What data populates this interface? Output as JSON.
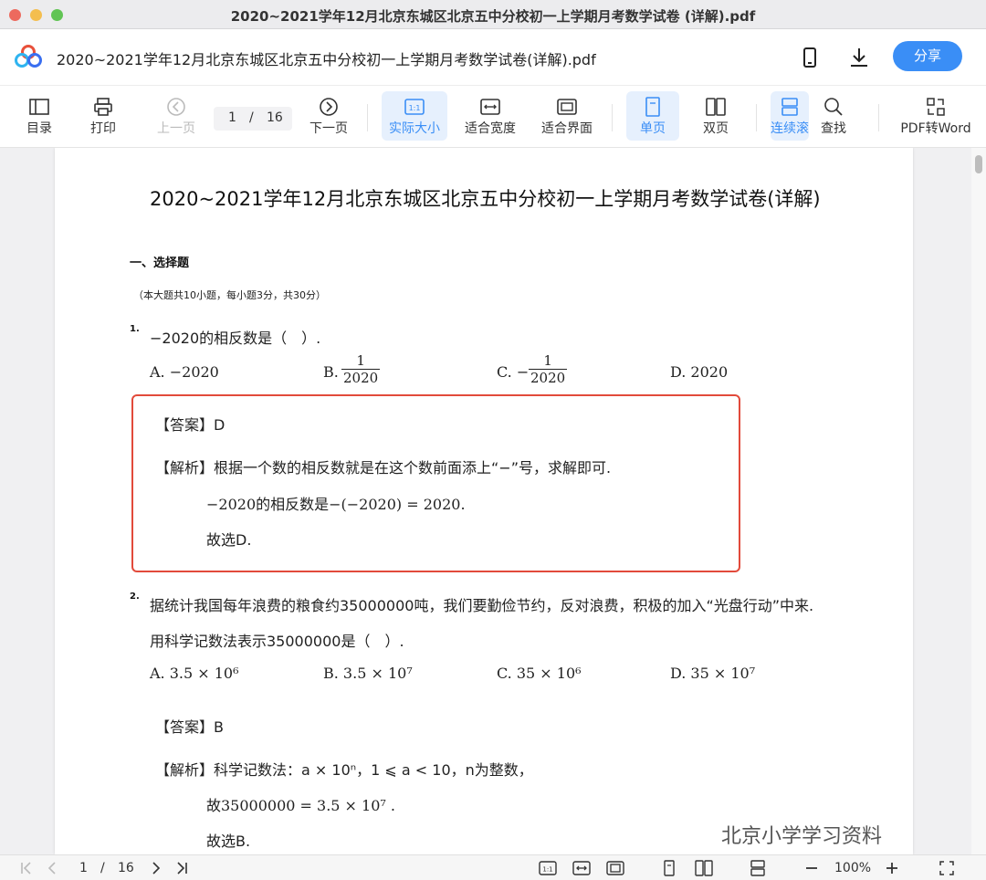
{
  "window": {
    "title": "2020~2021学年12月北京东城区北京五中分校初一上学期月考数学试卷 (详解).pdf"
  },
  "header": {
    "file_title": "2020~2021学年12月北京东城区北京五中分校初一上学期月考数学试卷(详解).pdf",
    "share_label": "分享"
  },
  "toolbar": {
    "toc": "目录",
    "print": "打印",
    "prev": "上一页",
    "page_current": "1",
    "page_sep": "/",
    "page_total": "16",
    "next": "下一页",
    "actual_size": "实际大小",
    "fit_width": "适合宽度",
    "fit_page": "适合界面",
    "single": "单页",
    "double": "双页",
    "continuous": "连续滚",
    "find": "查找",
    "to_word": "PDF转Word"
  },
  "doc": {
    "title": "2020~2021学年12月北京东城区北京五中分校初一上学期月考数学试卷(详解)",
    "section_title": "一、选择题",
    "section_desc": "（本大题共10小题，每小题3分，共30分）",
    "q1": {
      "num": "1.",
      "stem": "−2020的相反数是（　）.",
      "opt_a": "A. −2020",
      "opt_b": "B.",
      "opt_b_num": "1",
      "opt_b_den": "2020",
      "opt_c": "C. −",
      "opt_c_num": "1",
      "opt_c_den": "2020",
      "opt_d": "D. 2020",
      "answer": "【答案】D",
      "analysis": "【解析】根据一个数的相反数就是在这个数前面添上“−”号，求解即可.",
      "line2": "−2020的相反数是−(−2020) = 2020.",
      "line3": "故选D."
    },
    "q2": {
      "num": "2.",
      "stem1": "据统计我国每年浪费的粮食约35000000吨，我们要勤俭节约，反对浪费，积极的加入“光盘行动”中来.",
      "stem2": "用科学记数法表示35000000是（　）.",
      "opt_a": "A. 3.5 × 10⁶",
      "opt_b": "B. 3.5 × 10⁷",
      "opt_c": "C. 35 × 10⁶",
      "opt_d": "D. 35 × 10⁷",
      "answer": "【答案】B",
      "analysis": "【解析】科学记数法：a × 10ⁿ，1 ⩽ a < 10，n为整数，",
      "line2": "故35000000 = 3.5 × 10⁷ .",
      "line3": "故选B."
    }
  },
  "statusbar": {
    "page_current": "1",
    "page_sep": "/",
    "page_total": "16",
    "zoom": "100%"
  },
  "watermark": "北京小学学习资料",
  "colors": {
    "accent": "#3a8ef6",
    "answer_border": "#e24a3b"
  }
}
